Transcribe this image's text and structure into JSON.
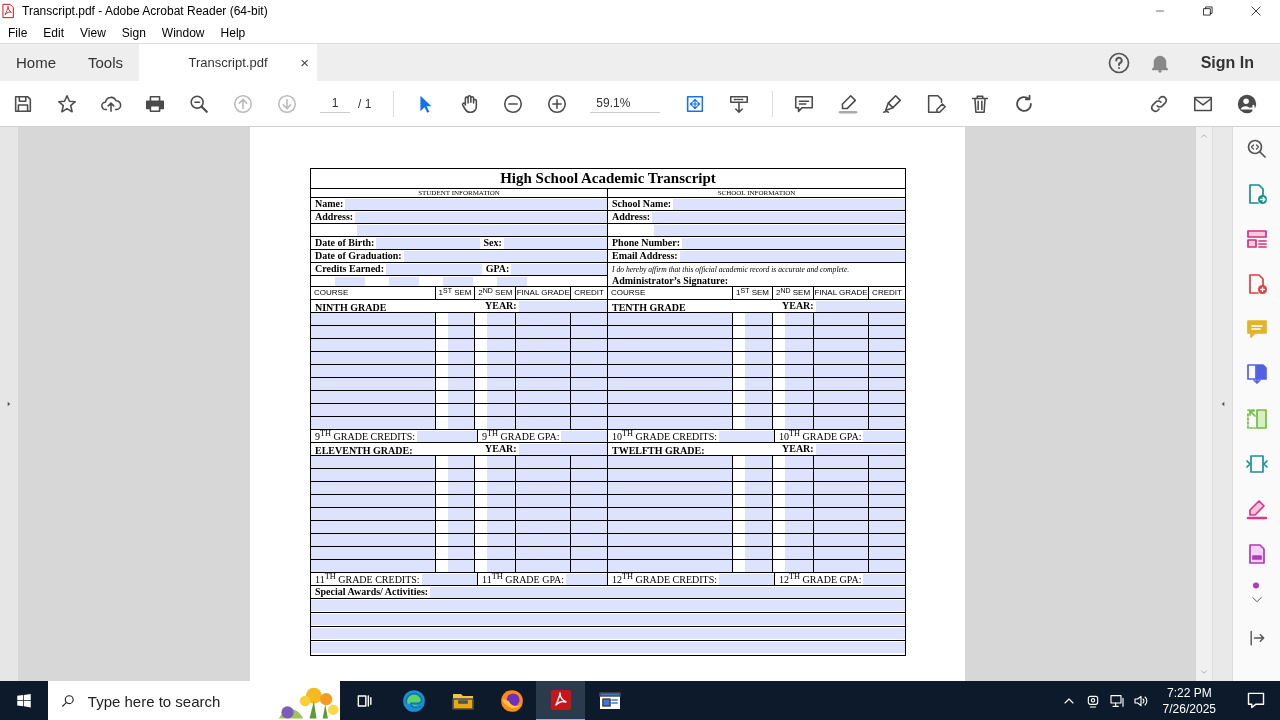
{
  "window": {
    "title": "Transcript.pdf - Adobe Acrobat Reader (64-bit)"
  },
  "menu": [
    "File",
    "Edit",
    "View",
    "Sign",
    "Window",
    "Help"
  ],
  "tabs": [
    {
      "label": "Home",
      "selected": false
    },
    {
      "label": "Tools",
      "selected": false
    },
    {
      "label": "Transcript.pdf",
      "selected": true,
      "close": "×"
    }
  ],
  "account": {
    "sign_in": "Sign In"
  },
  "toolbar": {
    "page": "1",
    "page_total": "/ 1",
    "zoom": "59.1%"
  },
  "document": {
    "title": "High School Academic Transcript",
    "student_heading": "STUDENT INFORMATION",
    "school_heading": "SCHOOL INFORMATION",
    "info_rows": [
      {
        "kind": "fields",
        "left": [
          {
            "label": "Name:"
          }
        ],
        "right": [
          {
            "label": "School Name:"
          }
        ]
      },
      {
        "kind": "fields",
        "left": [
          {
            "label": "Address:"
          }
        ],
        "right": [
          {
            "label": "Address:"
          }
        ]
      },
      {
        "kind": "blank"
      },
      {
        "kind": "fields",
        "left": [
          {
            "label": "Date of Birth:"
          },
          {
            "label": "Sex:"
          }
        ],
        "right": [
          {
            "label": "Phone Number:"
          }
        ]
      },
      {
        "kind": "fields",
        "left": [
          {
            "label": "Date of Graduation:"
          }
        ],
        "right": [
          {
            "label": "Email Address:"
          }
        ]
      },
      {
        "kind": "note",
        "left": [
          {
            "label": "Credits Earned:"
          },
          {
            "label": "GPA:"
          }
        ],
        "note": "I do hereby affirm that this official academic record is accurate and complete."
      },
      {
        "kind": "signature",
        "label": "Administrator’s Signature:"
      }
    ],
    "grade_blocks": [
      {
        "title": "NINTH GRADE",
        "year": "YEAR:",
        "columns": [
          "COURSE",
          "1$^{ST}$ SEM",
          "2$^{ND}$ SEM",
          "FINAL GRADE",
          "CREDIT"
        ],
        "credits": "9$^{TH}$ GRADE CREDITS:",
        "gpa": "9$^{TH}$ GRADE GPA:"
      },
      {
        "title": "TENTH GRADE",
        "year": "YEAR:",
        "columns": [
          "COURSE",
          "1$^{ST}$ SEM",
          "2$^{ND}$ SEM",
          "FINAL GRADE",
          "CREDIT"
        ],
        "credits": "10$^{TH}$ GRADE CREDITS:",
        "gpa": "10$^{TH}$ GRADE GPA:"
      },
      {
        "title": "ELEVENTH GRADE:",
        "year": "YEAR:",
        "credits": "11$^{TH}$ GRADE CREDITS:",
        "gpa": "11$^{TH}$ GRADE GPA:"
      },
      {
        "title": "TWELFTH GRADE:",
        "year": "YEAR:",
        "credits": "12$^{TH}$ GRADE CREDITS:",
        "gpa": "12$^{TH}$ GRADE GPA:"
      }
    ],
    "awards_label": "Special Awards/ Activities:"
  },
  "taskbar": {
    "search_placeholder": "Type here to search",
    "time": "7:22 PM",
    "date": "7/26/2025"
  }
}
